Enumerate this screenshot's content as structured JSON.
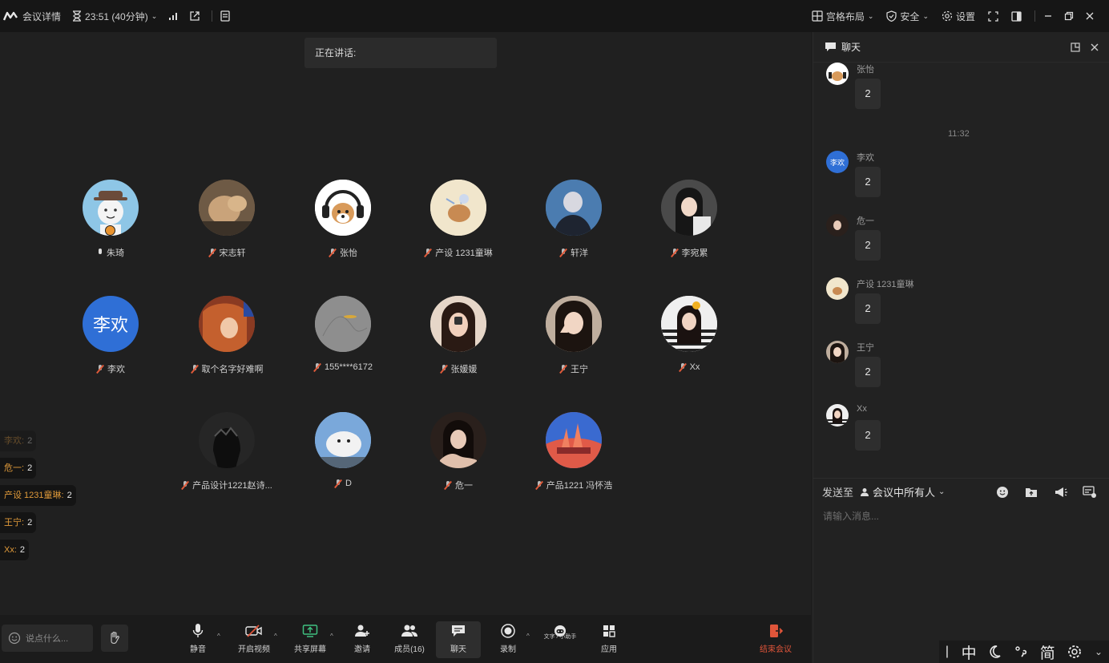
{
  "topbar": {
    "meeting_details": "会议详情",
    "timer": "23:51 (40分钟)",
    "gallery_layout": "宫格布局",
    "security": "安全",
    "settings": "设置"
  },
  "stage": {
    "speaking_label": "正在讲话:",
    "participants": [
      {
        "name": "朱琦",
        "mic": "on",
        "host": true
      },
      {
        "name": "宋志轩",
        "mic": "off"
      },
      {
        "name": "张怡",
        "mic": "off"
      },
      {
        "name": "产设 1231童琳",
        "mic": "off"
      },
      {
        "name": "轩洋",
        "mic": "off"
      },
      {
        "name": "李宛累",
        "mic": "off"
      },
      {
        "name": "李欢",
        "mic": "off",
        "avatar_text": "李欢"
      },
      {
        "name": "取个名字好难啊",
        "mic": "off"
      },
      {
        "name": "155****6172",
        "mic": "off"
      },
      {
        "name": "张媛媛",
        "mic": "off"
      },
      {
        "name": "王宁",
        "mic": "off"
      },
      {
        "name": "Xx",
        "mic": "off"
      },
      {
        "name": "产品设计1221赵诗...",
        "mic": "off"
      },
      {
        "name": "D",
        "mic": "off"
      },
      {
        "name": "危一",
        "mic": "off"
      },
      {
        "name": "产品1221 冯怀浩",
        "mic": "off"
      }
    ]
  },
  "reactions": [
    {
      "who": "李欢:",
      "count": "2"
    },
    {
      "who": "危一:",
      "count": "2"
    },
    {
      "who": "产设 1231童琳:",
      "count": "2"
    },
    {
      "who": "王宁:",
      "count": "2"
    },
    {
      "who": "Xx:",
      "count": "2"
    }
  ],
  "bottombar": {
    "say_placeholder": "说点什么...",
    "mute": "静音",
    "start_video": "开启视频",
    "share_screen": "共享屏幕",
    "invite": "邀请",
    "members": "成员(16)",
    "chat": "聊天",
    "record": "录制",
    "assistant": "文字 / 小助手",
    "apps": "应用",
    "end_meeting": "结束会议"
  },
  "chat": {
    "title": "聊天",
    "time_divider": "11:32",
    "messages": [
      {
        "sender": "张怡",
        "text": "2"
      },
      {
        "sender": "李欢",
        "text": "2",
        "avatar_text": "李欢"
      },
      {
        "sender": "危一",
        "text": "2"
      },
      {
        "sender": "产设 1231童琳",
        "text": "2"
      },
      {
        "sender": "王宁",
        "text": "2"
      },
      {
        "sender": "Xx",
        "text": "2"
      }
    ],
    "send_to_label": "发送至",
    "send_target": "会议中所有人",
    "input_placeholder": "请输入消息..."
  },
  "ime": {
    "mode_cn": "中",
    "simplified": "简"
  },
  "colors": {
    "accent_blue": "#2f6fd6",
    "end_red": "#e0553a",
    "reaction_orange": "#e09a3a"
  }
}
